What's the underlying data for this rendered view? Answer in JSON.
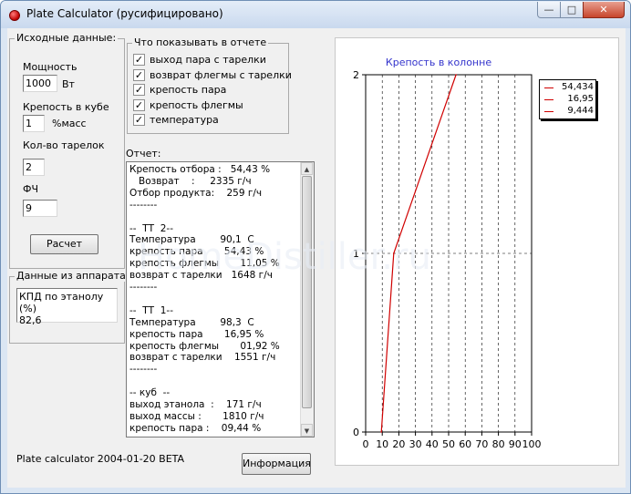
{
  "window": {
    "title": "Plate Calculator (русифицировано)",
    "min_glyph": "—",
    "max_glyph": "□",
    "close_glyph": "✕"
  },
  "input_group": {
    "title": "Исходные данные:",
    "power_label": "Мощность",
    "power_value": "1000",
    "power_unit": "Вт",
    "cube_strength_label": "Крепость в кубе",
    "cube_strength_value": "1",
    "cube_strength_unit": "%масс",
    "plates_label": "Кол-во тарелок",
    "plates_value": "2",
    "fch_label": "ФЧ",
    "fch_value": "9",
    "calc_button": "Расчет"
  },
  "device_group": {
    "title": "Данные из аппарата",
    "text_line1": "КПД по этанолу (%)",
    "text_line2": "82,6"
  },
  "report_options": {
    "title": "Что показывать в отчете",
    "items": [
      {
        "label": "выход пара с тарелки",
        "checked": true
      },
      {
        "label": "возврат флегмы с тарелки",
        "checked": true
      },
      {
        "label": "крепость пара",
        "checked": true
      },
      {
        "label": "крепость флегмы",
        "checked": true
      },
      {
        "label": "температура",
        "checked": true
      }
    ],
    "check_glyph": "✓"
  },
  "report": {
    "label": "Отчет:",
    "lines": [
      "Крепость отбора :   54,43 %",
      "   Возврат    :     2335 г/ч",
      "Отбор продукта:    259 г/ч",
      "--------",
      "",
      "--  ТТ  2--",
      "Температура        90,1  С",
      "крепость пара       54,43 %",
      "крепость флегмы       11,05 %",
      "возврат с тарелки   1648 г/ч",
      "--------",
      "",
      "--  ТТ  1--",
      "Температура        98,3  С",
      "крепость пара       16,95 %",
      "крепость флегмы       01,92 %",
      "возврат с тарелки    1551 г/ч",
      "--------",
      "",
      "-- куб  --",
      "выход этанола  :    171 г/ч",
      "выход массы :       1810 г/ч",
      "крепость пара :    09,44 %"
    ],
    "arrow_up": "▲",
    "arrow_down": "▼"
  },
  "footer": {
    "version": "Plate calculator 2004-01-20 BETA",
    "info_button": "Информация"
  },
  "watermark": "HomeDistiller.ru",
  "chart_data": {
    "type": "line",
    "title": "Крепость в колонне",
    "x_ticks": [
      "0",
      "10",
      "20",
      "30",
      "40",
      "50",
      "60",
      "70",
      "80",
      "90",
      "100"
    ],
    "y_ticks": [
      "0",
      "1",
      "2"
    ],
    "xlim": [
      0,
      100
    ],
    "ylim": [
      0,
      2
    ],
    "grid": true,
    "series": [
      {
        "x": [
          9.44,
          16.95,
          54.43
        ],
        "y": [
          0,
          1,
          2
        ],
        "color": "#d00000"
      }
    ],
    "legend": {
      "placement": "right",
      "entries": [
        "54,434",
        "16,95",
        "9,444"
      ]
    }
  },
  "colors": {
    "title_text": "#3333cc",
    "line": "#d00000"
  }
}
